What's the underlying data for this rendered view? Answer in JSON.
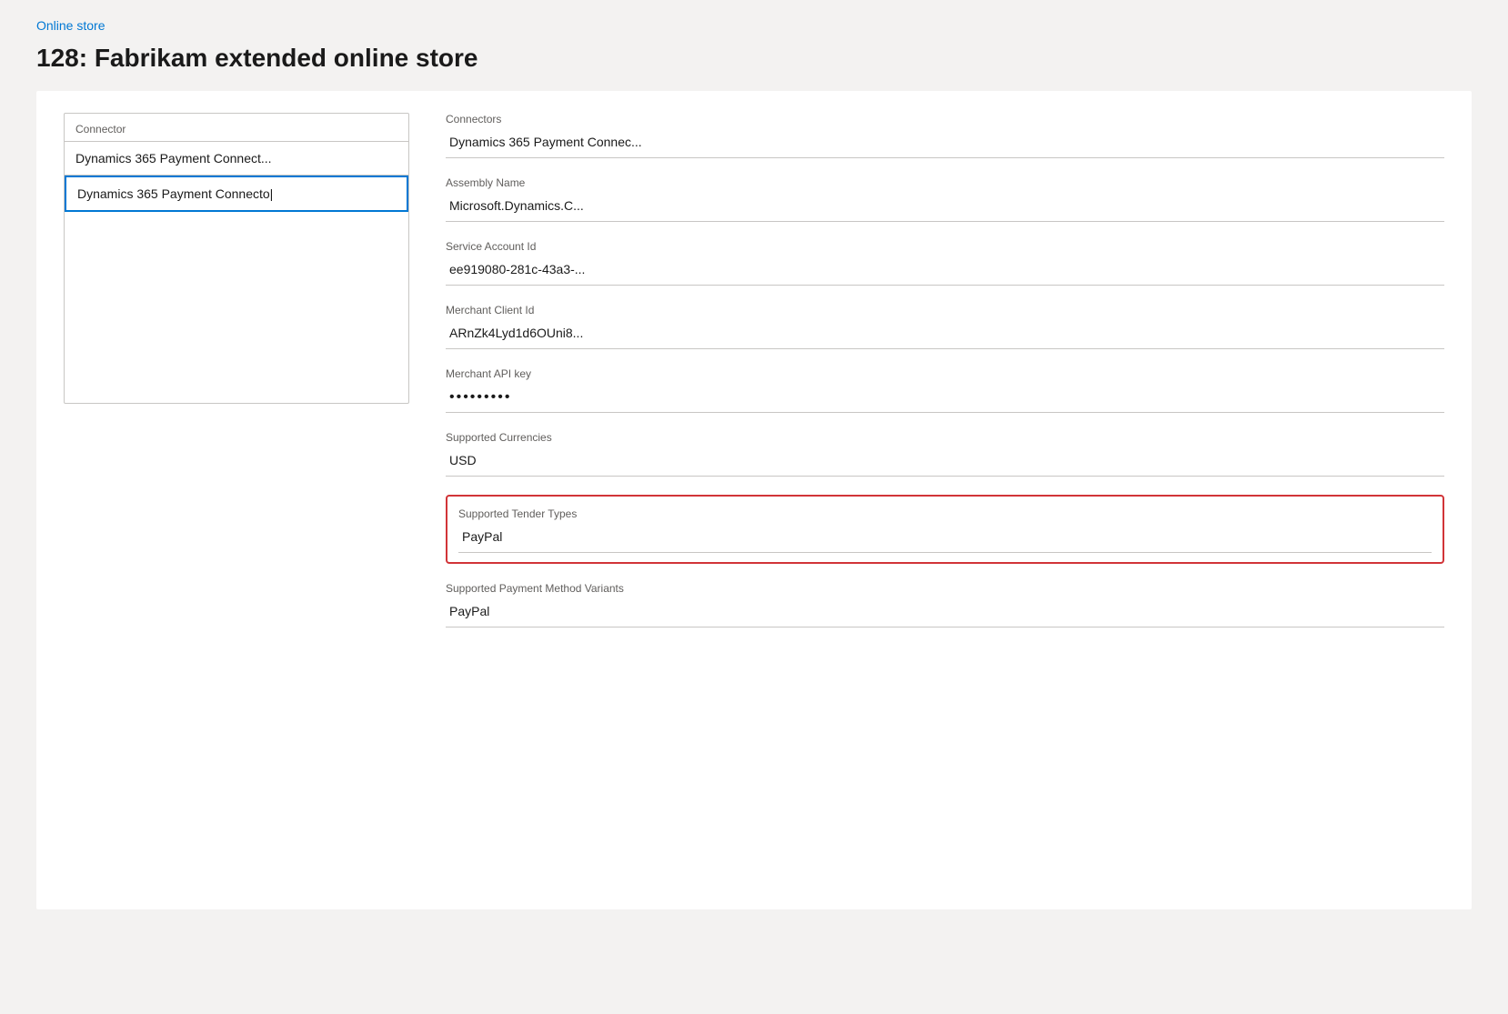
{
  "breadcrumb": {
    "label": "Online store",
    "link": "#"
  },
  "page": {
    "title": "128: Fabrikam extended online store"
  },
  "left_panel": {
    "connector_list_header": "Connector",
    "items": [
      {
        "label": "Dynamics 365 Payment Connect...",
        "selected": false
      },
      {
        "label": "Dynamics 365 Payment Connecto|",
        "selected": true
      }
    ]
  },
  "right_panel": {
    "fields": [
      {
        "id": "connectors",
        "label": "Connectors",
        "value": "Dynamics 365 Payment Connec...",
        "highlighted": false,
        "password": false
      },
      {
        "id": "assembly-name",
        "label": "Assembly Name",
        "value": "Microsoft.Dynamics.C...",
        "highlighted": false,
        "password": false
      },
      {
        "id": "service-account-id",
        "label": "Service Account Id",
        "value": "ee919080-281c-43a3-...",
        "highlighted": false,
        "password": false
      },
      {
        "id": "merchant-client-id",
        "label": "Merchant Client Id",
        "value": "ARnZk4Lyd1d6OUni8...",
        "highlighted": false,
        "password": false
      },
      {
        "id": "merchant-api-key",
        "label": "Merchant API key",
        "value": "•••••••••",
        "highlighted": false,
        "password": true
      },
      {
        "id": "supported-currencies",
        "label": "Supported Currencies",
        "value": "USD",
        "highlighted": false,
        "password": false
      }
    ],
    "highlighted_field": {
      "label": "Supported Tender Types",
      "value": "PayPal"
    },
    "bottom_field": {
      "label": "Supported Payment Method Variants",
      "value": "PayPal"
    }
  }
}
